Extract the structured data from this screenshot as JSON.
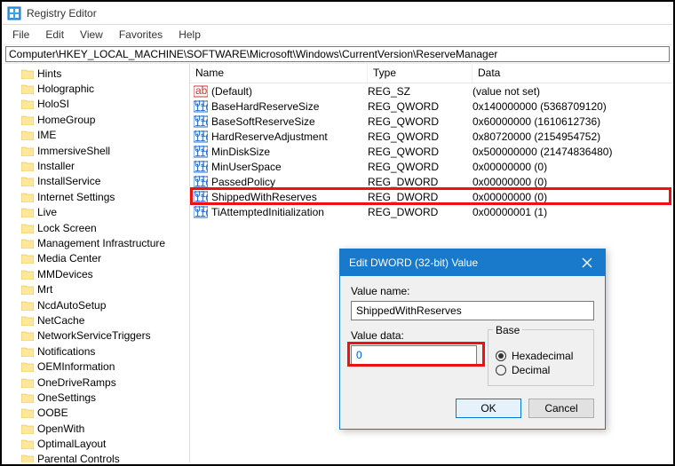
{
  "window": {
    "title": "Registry Editor"
  },
  "menu": {
    "items": [
      "File",
      "Edit",
      "View",
      "Favorites",
      "Help"
    ]
  },
  "address": {
    "label": "Computer",
    "path": "\\HKEY_LOCAL_MACHINE\\SOFTWARE\\Microsoft\\Windows\\CurrentVersion\\ReserveManager"
  },
  "tree": {
    "items": [
      "Hints",
      "Holographic",
      "HoloSI",
      "HomeGroup",
      "IME",
      "ImmersiveShell",
      "Installer",
      "InstallService",
      "Internet Settings",
      "Live",
      "Lock Screen",
      "Management Infrastructure",
      "Media Center",
      "MMDevices",
      "Mrt",
      "NcdAutoSetup",
      "NetCache",
      "NetworkServiceTriggers",
      "Notifications",
      "OEMInformation",
      "OneDriveRamps",
      "OneSettings",
      "OOBE",
      "OpenWith",
      "OptimalLayout",
      "Parental Controls"
    ]
  },
  "list": {
    "columns": {
      "name": "Name",
      "type": "Type",
      "data": "Data"
    },
    "rows": [
      {
        "icon": "sz",
        "name": "(Default)",
        "type": "REG_SZ",
        "data": "(value not set)"
      },
      {
        "icon": "bin",
        "name": "BaseHardReserveSize",
        "type": "REG_QWORD",
        "data": "0x140000000 (5368709120)"
      },
      {
        "icon": "bin",
        "name": "BaseSoftReserveSize",
        "type": "REG_QWORD",
        "data": "0x60000000 (1610612736)"
      },
      {
        "icon": "bin",
        "name": "HardReserveAdjustment",
        "type": "REG_QWORD",
        "data": "0x80720000 (2154954752)"
      },
      {
        "icon": "bin",
        "name": "MinDiskSize",
        "type": "REG_QWORD",
        "data": "0x500000000 (21474836480)"
      },
      {
        "icon": "bin",
        "name": "MinUserSpace",
        "type": "REG_QWORD",
        "data": "0x00000000 (0)"
      },
      {
        "icon": "bin",
        "name": "PassedPolicy",
        "type": "REG_DWORD",
        "data": "0x00000000 (0)"
      },
      {
        "icon": "bin",
        "name": "ShippedWithReserves",
        "type": "REG_DWORD",
        "data": "0x00000000 (0)",
        "hl": true
      },
      {
        "icon": "bin",
        "name": "TiAttemptedInitialization",
        "type": "REG_DWORD",
        "data": "0x00000001 (1)"
      }
    ]
  },
  "dialog": {
    "title": "Edit DWORD (32-bit) Value",
    "name_label": "Value name:",
    "name_value": "ShippedWithReserves",
    "data_label": "Value data:",
    "data_value": "0",
    "base_label": "Base",
    "base_hex": "Hexadecimal",
    "base_dec": "Decimal",
    "ok": "OK",
    "cancel": "Cancel"
  }
}
